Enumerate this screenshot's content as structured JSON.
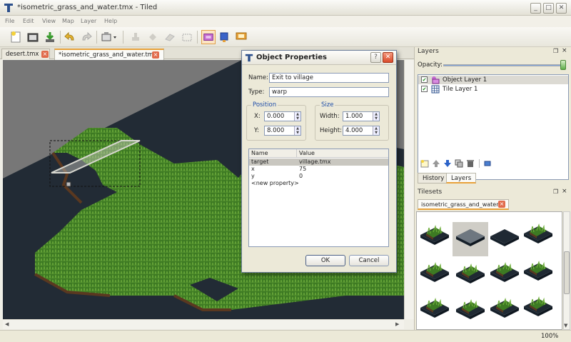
{
  "window": {
    "title": "*isometric_grass_and_water.tmx - Tiled",
    "minimize": "_",
    "maximize": "□",
    "close": "✕"
  },
  "menu": [
    "File",
    "Edit",
    "View",
    "Map",
    "Layer",
    "Help"
  ],
  "tabs": [
    {
      "label": "desert.tmx",
      "active": false
    },
    {
      "label": "*isometric_grass_and_water.tmx",
      "active": true
    }
  ],
  "dialog": {
    "title": "Object Properties",
    "help": "?",
    "close": "✕",
    "name_label": "Name:",
    "name_value": "Exit to village",
    "type_label": "Type:",
    "type_value": "warp",
    "position_group": "Position",
    "x_label": "X:",
    "x_value": "0.000",
    "y_label": "Y:",
    "y_value": "8.000",
    "size_group": "Size",
    "width_label": "Width:",
    "width_value": "1.000",
    "height_label": "Height:",
    "height_value": "4.000",
    "table_headers": [
      "Name",
      "Value"
    ],
    "table_rows": [
      {
        "name": "target",
        "value": "village.tmx"
      },
      {
        "name": "x",
        "value": "75"
      },
      {
        "name": "y",
        "value": "0"
      },
      {
        "name": "<new property>",
        "value": ""
      }
    ],
    "ok": "OK",
    "cancel": "Cancel"
  },
  "layers_panel": {
    "title": "Layers",
    "opacity_label": "Opacity:",
    "opacity": 1.0,
    "layers": [
      {
        "name": "Object Layer 1",
        "visible": true,
        "selected": true
      },
      {
        "name": "Tile Layer 1",
        "visible": true,
        "selected": false
      }
    ],
    "tab_history": "History",
    "tab_layers": "Layers"
  },
  "tilesets_panel": {
    "title": "Tilesets",
    "tab_label": "isometric_grass_and_water"
  },
  "status": {
    "zoom": "100%"
  },
  "colors": {
    "accent": "#e8a23a",
    "water": "#232b35",
    "grass": "#3f7a22",
    "selection": "#c9c7c0",
    "close_red": "#e16b4c"
  }
}
